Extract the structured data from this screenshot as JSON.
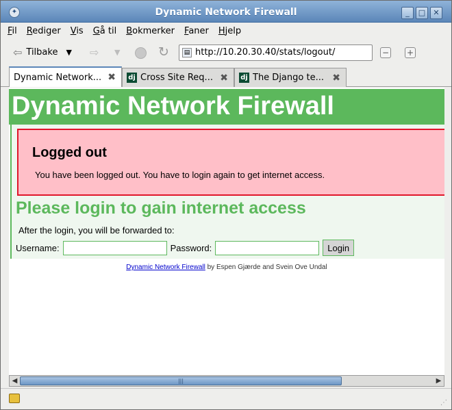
{
  "window": {
    "title": "Dynamic Network Firewall"
  },
  "menu": [
    "Fil",
    "Rediger",
    "Vis",
    "Gå til",
    "Bokmerker",
    "Faner",
    "Hjelp"
  ],
  "nav": {
    "back_label": "Tilbake",
    "url": "http://10.20.30.40/stats/logout/"
  },
  "tabs": [
    {
      "label": "Dynamic Network...",
      "active": true
    },
    {
      "label": "Cross Site Req...",
      "favicon": "dj"
    },
    {
      "label": "The Django te...",
      "favicon": "dj"
    }
  ],
  "page": {
    "heading": "Dynamic Network Firewall",
    "alert_title": "Logged out",
    "alert_text": "You have been logged out. You have to login again to get internet access.",
    "login_title": "Please login to gain internet access",
    "forward_text": "After the login, you will be forwarded to:",
    "username_label": "Username:",
    "username_value": "",
    "password_label": "Password:",
    "password_value": "",
    "login_button": "Login",
    "footer_link": "Dynamic Network Firewall",
    "footer_text": " by Espen Gjærde and Svein Ove Undal"
  },
  "colors": {
    "accent_green": "#5cb85c",
    "alert_bg": "#ffbfc8",
    "alert_border": "#e0152a",
    "link": "#0000cc"
  },
  "icons": {
    "back": "back-arrow-icon",
    "forward": "forward-arrow-icon",
    "stop": "stop-icon",
    "reload": "reload-icon",
    "lock": "lock-icon"
  }
}
